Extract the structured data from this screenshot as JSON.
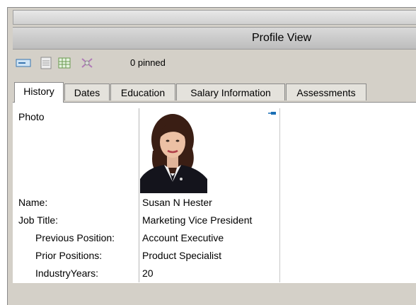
{
  "window": {
    "title": "Profile View"
  },
  "toolbar": {
    "icons": [
      "card-view-icon",
      "document-icon",
      "grid-icon",
      "unpin-icon"
    ],
    "pinned_text": "0 pinned"
  },
  "tabs": [
    {
      "label": "History",
      "active": true
    },
    {
      "label": "Dates",
      "active": false
    },
    {
      "label": "Education",
      "active": false
    },
    {
      "label": "Salary Information",
      "active": false
    },
    {
      "label": "Assessments",
      "active": false
    }
  ],
  "profile": {
    "photo_label": "Photo",
    "fields": [
      {
        "label": "Name:",
        "value": "Susan N Hester"
      },
      {
        "label": "Job Title:",
        "value": "Marketing Vice President"
      },
      {
        "label": "Previous Position:",
        "value": "Account Executive"
      },
      {
        "label": "Prior Positions:",
        "value": "Product Specialist"
      },
      {
        "label": "IndustryYears:",
        "value": "20"
      }
    ]
  },
  "colors": {
    "accent": "#1a6fb5",
    "window_bg": "#d4d0c8"
  }
}
